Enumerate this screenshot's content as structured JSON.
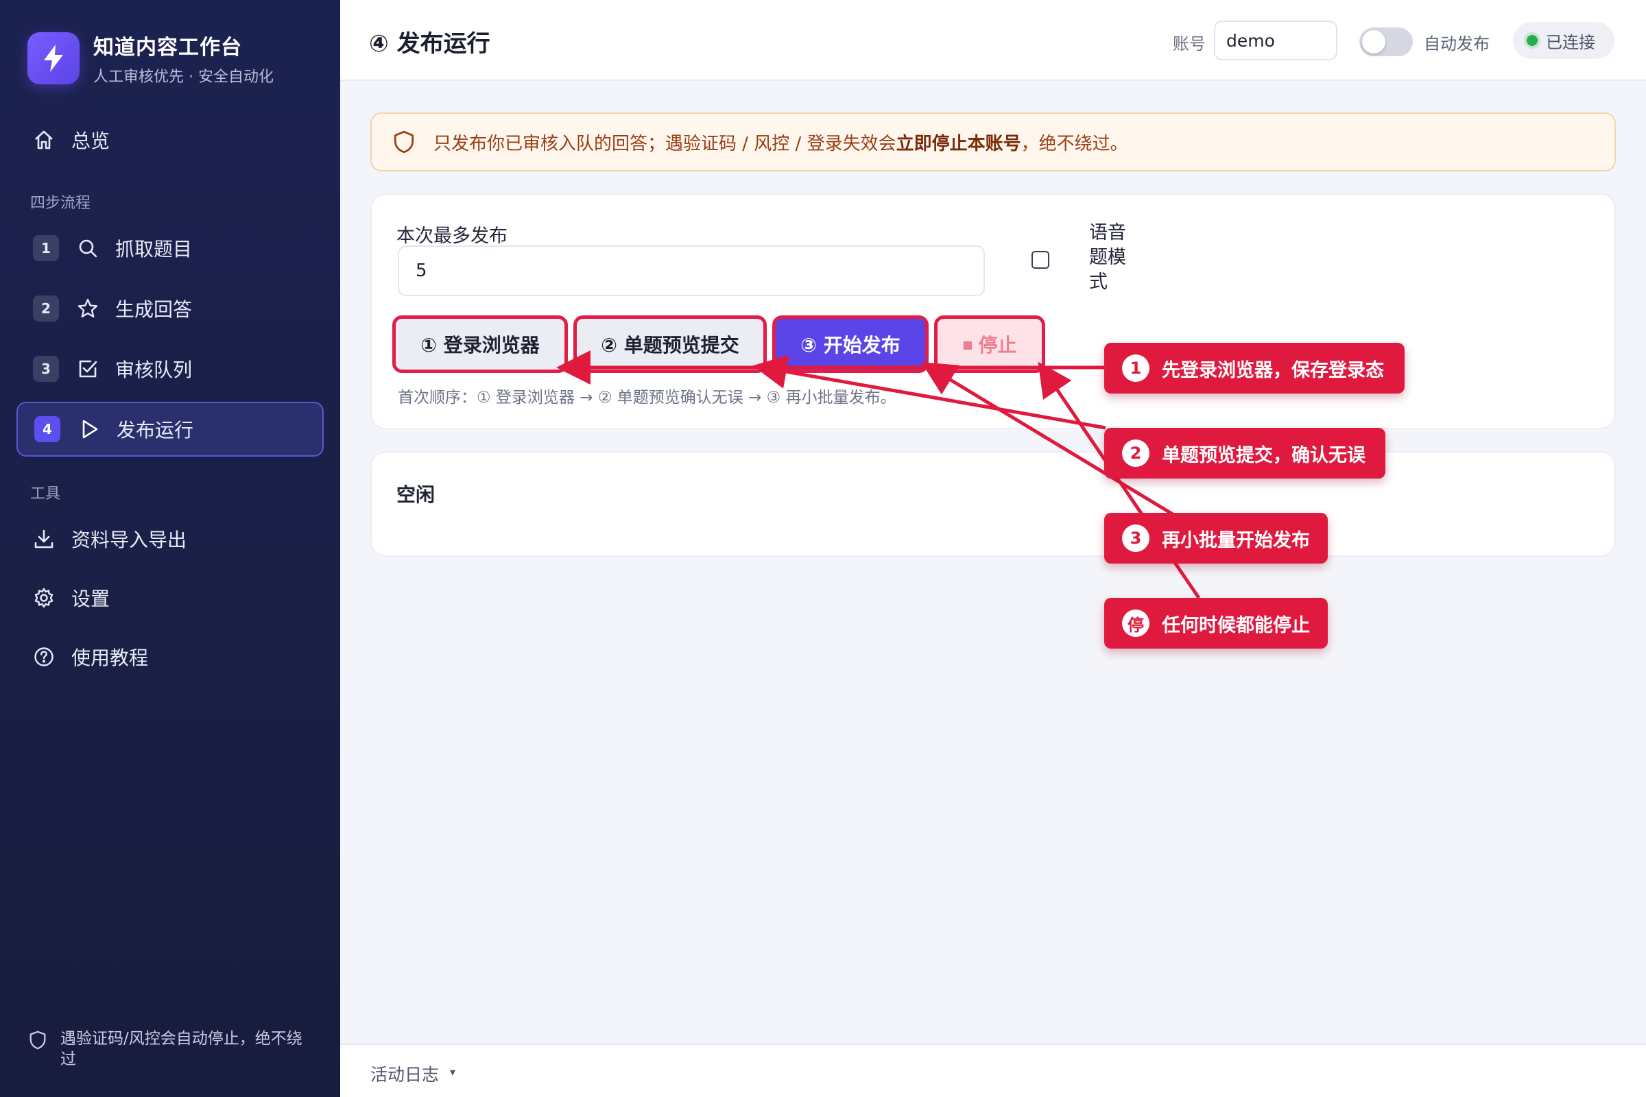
{
  "brand": {
    "title": "知道内容工作台",
    "subtitle": "人工审核优先 · 安全自动化"
  },
  "nav": {
    "overview": "总览",
    "section_flow": "四步流程",
    "steps": [
      {
        "num": "1",
        "label": "抓取题目"
      },
      {
        "num": "2",
        "label": "生成回答"
      },
      {
        "num": "3",
        "label": "审核队列"
      },
      {
        "num": "4",
        "label": "发布运行"
      }
    ],
    "section_tools": "工具",
    "tools": [
      {
        "label": "资料导入导出"
      },
      {
        "label": "设置"
      },
      {
        "label": "使用教程"
      }
    ],
    "footer_note": "遇验证码/风控会自动停止，绝不绕过"
  },
  "topbar": {
    "title": "④ 发布运行",
    "account_label": "账号",
    "account_value": "demo",
    "auto_publish_label": "自动发布",
    "connection_status": "已连接"
  },
  "notice": {
    "text_before": "只发布你已审核入队的回答；遇验证码 / 风控 / 登录失效会",
    "text_bold": "立即停止本账号",
    "text_after": "，绝不绕过。"
  },
  "publish_form": {
    "max_label": "本次最多发布",
    "max_value": "5",
    "voice_mode_label": "语音题模式",
    "buttons": {
      "login": "① 登录浏览器",
      "preview": "② 单题预览提交",
      "start": "③ 开始发布",
      "stop": "停止"
    },
    "stop_glyph": "■",
    "order_note": "首次顺序：① 登录浏览器 → ② 单题预览确认无误 → ③ 再小批量发布。"
  },
  "status": {
    "text": "空闲"
  },
  "log": {
    "label": "活动日志",
    "caret": "▾"
  },
  "callouts": [
    {
      "badge": "1",
      "text": "先登录浏览器，保存登录态"
    },
    {
      "badge": "2",
      "text": "单题预览提交，确认无误"
    },
    {
      "badge": "3",
      "text": "再小批量开始发布"
    },
    {
      "badge": "停",
      "text": "任何时候都能停止"
    }
  ],
  "colors": {
    "accent": "#5b45e8",
    "annotation": "#e0193e",
    "sidebar_bg": "#1c2250",
    "connected": "#22b04b"
  }
}
